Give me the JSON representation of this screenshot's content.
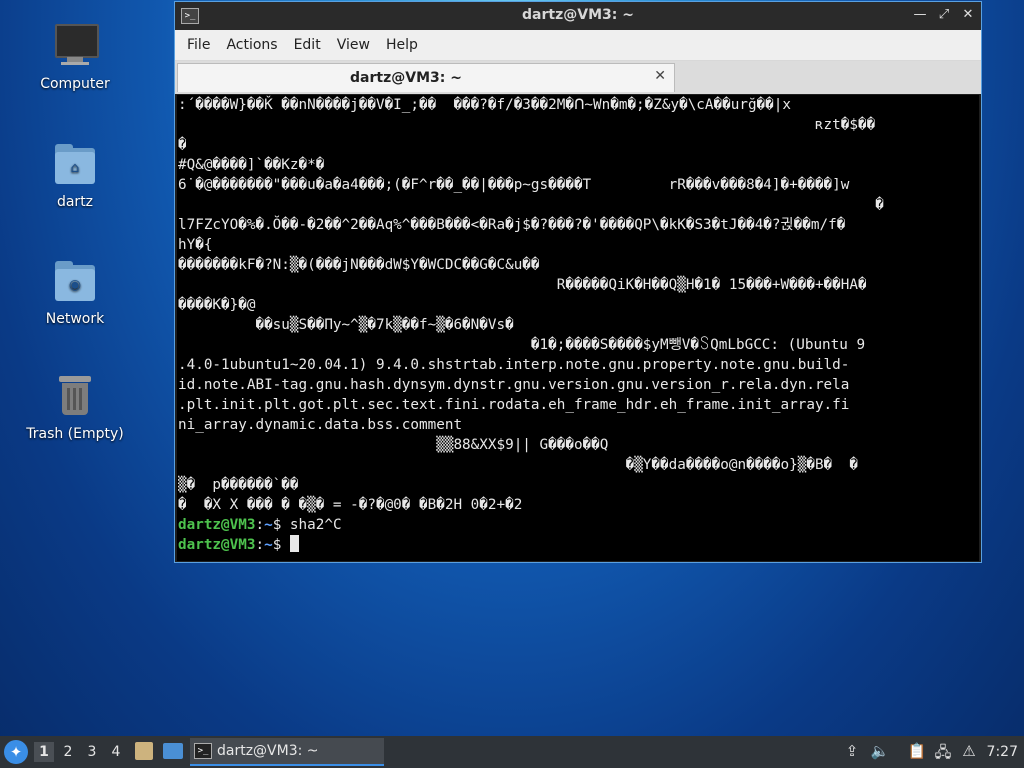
{
  "desktop": {
    "icons": [
      {
        "label": "Computer",
        "icon": "computer-icon"
      },
      {
        "label": "dartz",
        "icon": "home-folder-icon"
      },
      {
        "label": "Network",
        "icon": "network-folder-icon"
      },
      {
        "label": "Trash (Empty)",
        "icon": "trash-icon"
      }
    ]
  },
  "window": {
    "title": "dartz@VM3: ~",
    "buttons": {
      "minimize": "—",
      "maximize": "⤢",
      "close": "✕"
    },
    "menu": [
      "File",
      "Actions",
      "Edit",
      "View",
      "Help"
    ],
    "tab": {
      "label": "dartz@VM3: ~",
      "close": "✕"
    }
  },
  "terminal": {
    "lines": [
      ":´����W}��Ǩ ��nN����j��V�I_;��  ���?�f/�3��2M�ᑎ~Wn�m�;�Z&y�\\cA��urğ��|x",
      "                                                                          ʀzt�$��",
      "�",
      "#Q&@����]`��Kz�*�",
      "6˙�@�������\"���u�a�a4���;(�F^r��_��|���p~gs����T         rR���v���8�4]�+����]w",
      "                                                                                 �",
      "l7FZcYO�%�.Ŏ��-�2��^2��Aq%^���B���<�Ra�j$�?���?�'����QP\\�kK�S3�tJ��4�?귅��m/f�",
      "hY�{",
      "�������kF�?N:▒�(���jN���dW$Y�WCDC��G�C&u��",
      "                                            R�����QiK�H��Q▒H�1� 15���+W���+��HA�",
      "����K�}�@",
      "         ��su▒S��Пy~^▒�7k▒��f~▒�6�N�Vs�",
      "                                         �1�;����S����$yM뺑V�꒚QmLbGCC: (Ubuntu 9",
      ".4.0-1ubuntu1~20.04.1) 9.4.0.shstrtab.interp.note.gnu.property.note.gnu.build-",
      "id.note.ABI-tag.gnu.hash.dynsym.dynstr.gnu.version.gnu.version_r.rela.dyn.rela",
      ".plt.init.plt.got.plt.sec.text.fini.rodata.eh_frame_hdr.eh_frame.init_array.fi",
      "ni_array.dynamic.data.bss.comment",
      "                              ▒▒88&XX$9|| G���o��Q",
      "                                                    �▒Y��da����o@n����o}▒�B�  �",
      "▒�  p������`��",
      "�  �X X ��� � �▒� = -�?�@0� �B�2H 0�2+�2"
    ],
    "prompt_user": "dartz@VM3",
    "prompt_sep": ":",
    "prompt_path": "~",
    "prompt_symbol": "$",
    "command1": " sha2^C",
    "command2": " "
  },
  "taskbar": {
    "start_icon": "lubuntu-start-icon",
    "workspaces": [
      "1",
      "2",
      "3",
      "4"
    ],
    "active_workspace": "1",
    "task_title": "dartz@VM3: ~",
    "clock": "7:27",
    "tray_icons": [
      "update-icon",
      "volume-icon",
      "clipboard-icon",
      "network-icon",
      "notification-icon"
    ]
  }
}
